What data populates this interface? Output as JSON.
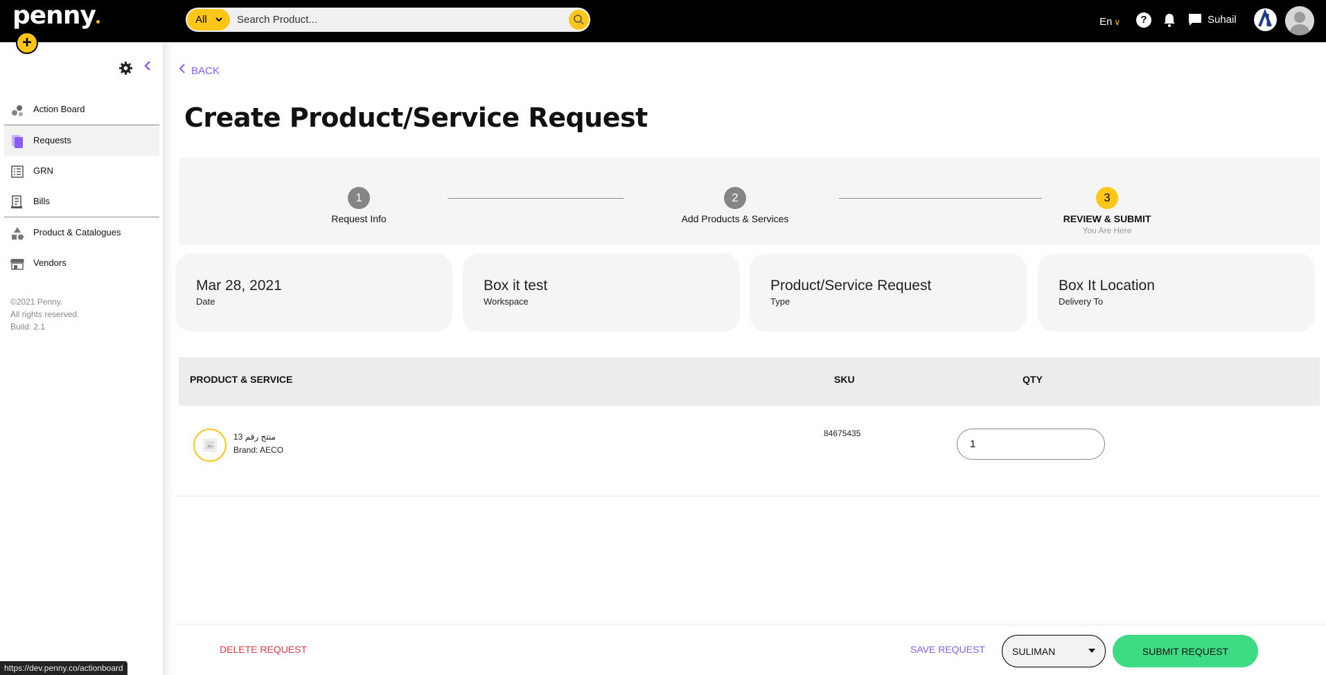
{
  "app": {
    "logo_text": "penny",
    "add_button": "+"
  },
  "search": {
    "category": "All",
    "placeholder": "Search Product..."
  },
  "topbar": {
    "language": "En",
    "help_label": "?",
    "user_name": "Suhail"
  },
  "sidebar": {
    "items": [
      {
        "label": "Action Board",
        "icon": "action-board-icon"
      },
      {
        "label": "Requests",
        "icon": "requests-icon",
        "active": true
      },
      {
        "label": "GRN",
        "icon": "grn-icon"
      },
      {
        "label": "Bills",
        "icon": "bills-icon"
      },
      {
        "label": "Product & Catalogues",
        "icon": "catalogue-icon"
      },
      {
        "label": "Vendors",
        "icon": "vendors-icon"
      }
    ],
    "footer": {
      "copyright": "©2021 Penny.",
      "rights": "All rights reserved.",
      "build": "Build: 2.1"
    }
  },
  "main": {
    "back_label": "BACK",
    "title": "Create Product/Service Request",
    "steps": [
      {
        "number": "1",
        "label": "Request Info"
      },
      {
        "number": "2",
        "label": "Add Products & Services"
      },
      {
        "number": "3",
        "label": "REVIEW & SUBMIT",
        "sub": "You Are Here",
        "current": true
      }
    ],
    "cards": [
      {
        "value": "Mar 28, 2021",
        "caption": "Date"
      },
      {
        "value": "Box it test",
        "caption": "Workspace"
      },
      {
        "value": "Product/Service Request",
        "caption": "Type"
      },
      {
        "value": "Box It Location",
        "caption": "Delivery To"
      }
    ],
    "table": {
      "headers": {
        "product": "PRODUCT & SERVICE",
        "sku": "SKU",
        "qty": "QTY"
      },
      "rows": [
        {
          "name": "منتج رقم 13",
          "brand": "Brand: AECO",
          "sku": "84675435",
          "qty": "1"
        }
      ]
    }
  },
  "actions": {
    "delete": "DELETE REQUEST",
    "save": "SAVE REQUEST",
    "approver": "SULIMAN",
    "submit": "SUBMIT REQUEST"
  },
  "status_bar": {
    "url": "https://dev.penny.co/actionboard"
  },
  "colors": {
    "brand_yellow": "#ffc61a",
    "accent_purple": "#8b5cf6",
    "danger_red": "#e53945",
    "submit_green": "#3ddc84"
  }
}
